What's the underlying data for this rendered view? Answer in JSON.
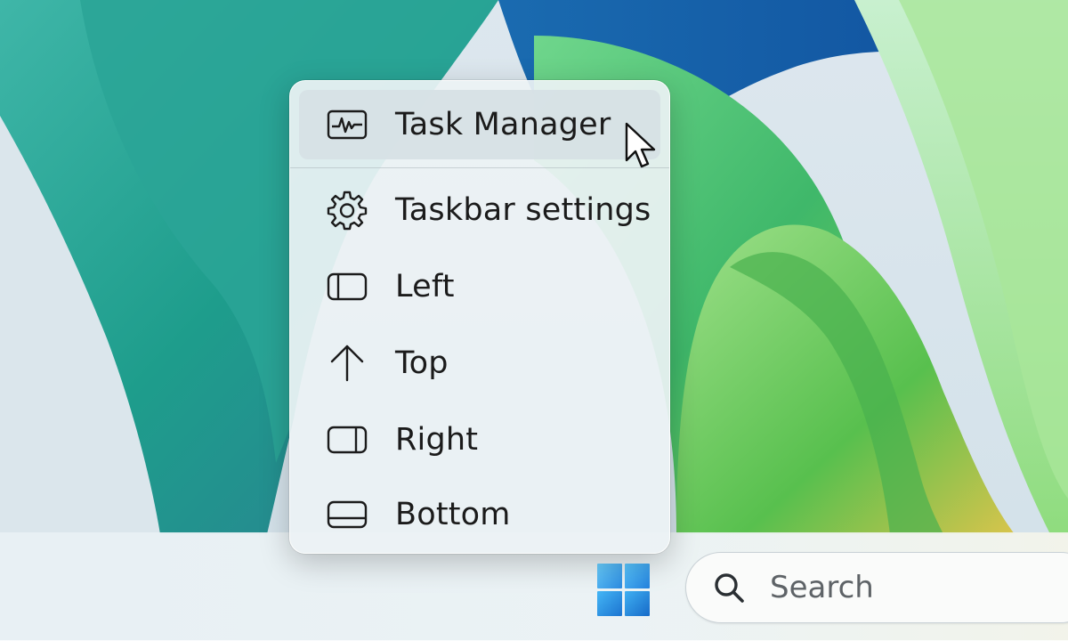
{
  "context_menu": {
    "items": [
      {
        "label": "Task Manager",
        "icon": "activity-monitor-icon"
      },
      {
        "label": "Taskbar settings",
        "icon": "gear-icon"
      },
      {
        "label": "Left",
        "icon": "dock-left-icon"
      },
      {
        "label": "Top",
        "icon": "arrow-up-icon"
      },
      {
        "label": "Right",
        "icon": "dock-right-icon"
      },
      {
        "label": "Bottom",
        "icon": "dock-bottom-icon"
      }
    ],
    "hovered_item": "Task Manager"
  },
  "taskbar": {
    "start_icon": "windows-logo-icon",
    "search": {
      "placeholder": "Search",
      "icon": "search-icon"
    }
  },
  "colors": {
    "menu_background": "#ECF2F4",
    "hover_background": "#D6E0E4",
    "text": "#1B1B1B",
    "start_blue": "#2B8AE0"
  }
}
